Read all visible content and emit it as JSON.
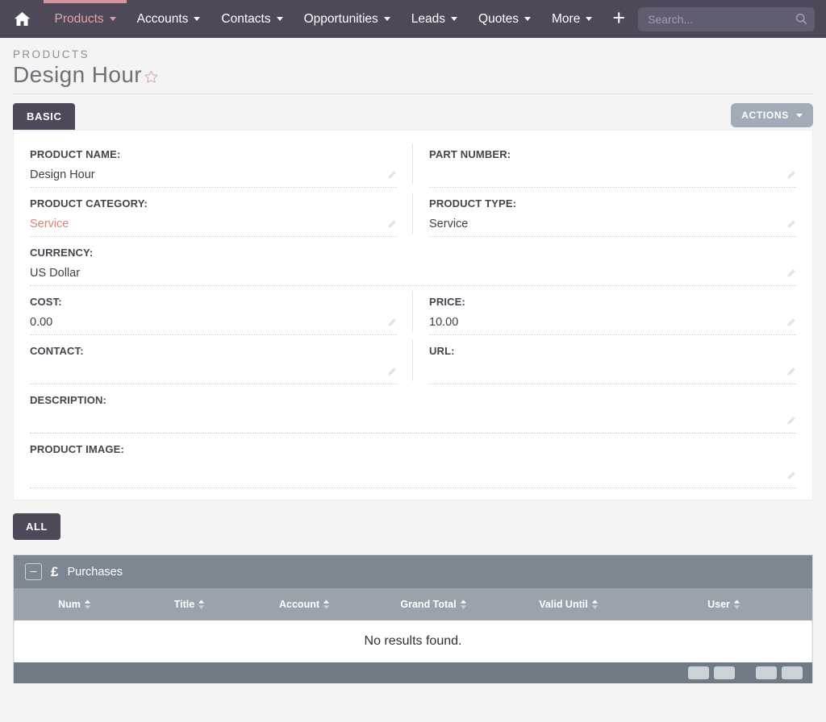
{
  "navbar": {
    "home_icon": "home-icon",
    "items": [
      {
        "label": "Products",
        "active": true
      },
      {
        "label": "Accounts",
        "active": false
      },
      {
        "label": "Contacts",
        "active": false
      },
      {
        "label": "Opportunities",
        "active": false
      },
      {
        "label": "Leads",
        "active": false
      },
      {
        "label": "Quotes",
        "active": false
      },
      {
        "label": "More",
        "active": false
      }
    ],
    "add_label": "+",
    "search": {
      "value": "",
      "placeholder": "Search...",
      "icon": "search-icon"
    },
    "colors": {
      "bar": "#4e4858",
      "active_text": "#e3a5a9",
      "active_underline": "#d8949c",
      "search_bg": "#625c70"
    }
  },
  "header": {
    "breadcrumb": "PRODUCTS",
    "title": "Design Hour",
    "favorite_icon": "star-outline-icon",
    "favorite_color": "#e0a8ab"
  },
  "tabs": {
    "basic_label": "BASIC",
    "actions_label": "ACTIONS",
    "all_label": "ALL"
  },
  "detail": {
    "rows": [
      {
        "cells": [
          {
            "label": "PRODUCT NAME:",
            "value": "Design Hour",
            "link": false
          },
          {
            "label": "PART NUMBER:",
            "value": "",
            "link": false
          }
        ]
      },
      {
        "cells": [
          {
            "label": "PRODUCT CATEGORY:",
            "value": "Service",
            "link": true
          },
          {
            "label": "PRODUCT TYPE:",
            "value": "Service",
            "link": false
          }
        ]
      },
      {
        "cells": [
          {
            "label": "CURRENCY:",
            "value": "US Dollar",
            "link": false
          }
        ]
      },
      {
        "cells": [
          {
            "label": "COST:",
            "value": "0.00",
            "link": false
          },
          {
            "label": "PRICE:",
            "value": "10.00",
            "link": false
          }
        ]
      },
      {
        "cells": [
          {
            "label": "CONTACT:",
            "value": "",
            "link": false
          },
          {
            "label": "URL:",
            "value": "",
            "link": false
          }
        ]
      },
      {
        "cells": [
          {
            "label": "DESCRIPTION:",
            "value": "",
            "link": false
          }
        ]
      },
      {
        "cells": [
          {
            "label": "PRODUCT IMAGE:",
            "value": "",
            "link": false
          }
        ]
      }
    ],
    "edit_icon": "pencil-icon"
  },
  "purchases": {
    "collapse_label": "–",
    "currency_icon": "pound-icon",
    "title": "Purchases",
    "columns": [
      "Num",
      "Title",
      "Account",
      "Grand Total",
      "Valid Until",
      "User"
    ],
    "rows": [],
    "empty_message": "No results found.",
    "colors": {
      "header": "#7d8791",
      "thead": "#9aa3ac",
      "footer": "#6f7a85"
    }
  }
}
